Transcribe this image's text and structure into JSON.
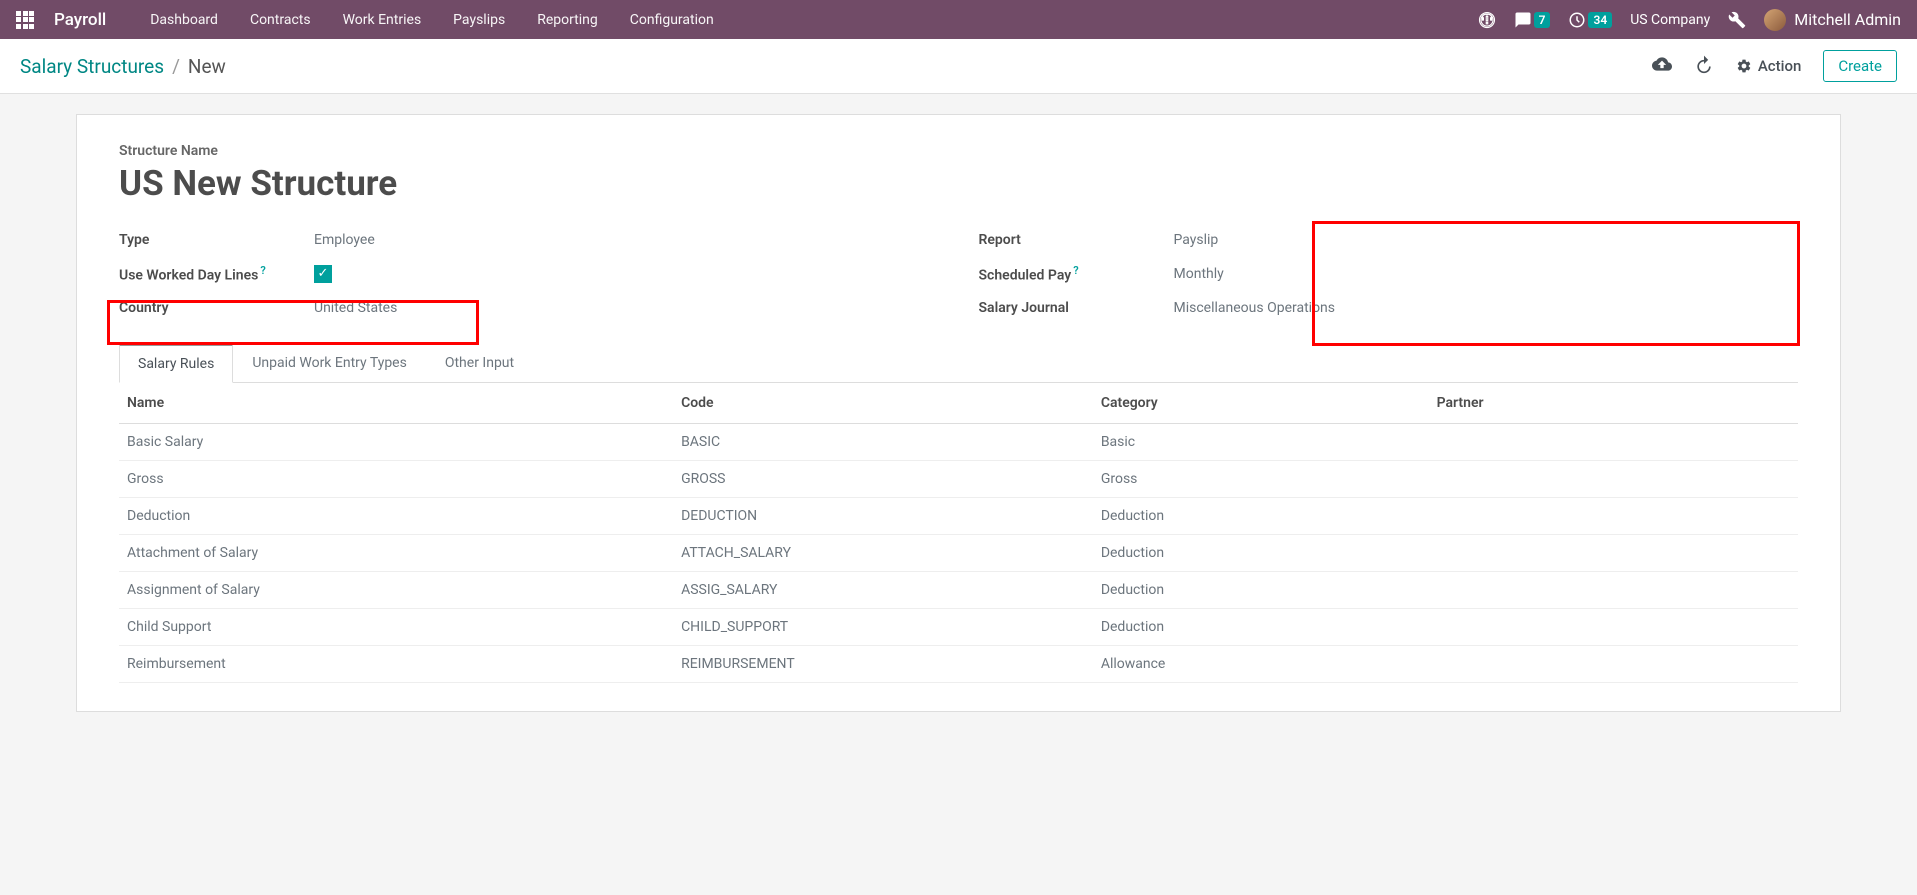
{
  "app_name": "Payroll",
  "nav": {
    "items": [
      "Dashboard",
      "Contracts",
      "Work Entries",
      "Payslips",
      "Reporting",
      "Configuration"
    ]
  },
  "header": {
    "messages_count": "7",
    "activities_count": "34",
    "company": "US Company",
    "user_name": "Mitchell Admin"
  },
  "breadcrumb": {
    "parent": "Salary Structures",
    "current": "New"
  },
  "actions": {
    "action_label": "Action",
    "create_label": "Create"
  },
  "form": {
    "structure_name_label": "Structure Name",
    "structure_name": "US New Structure",
    "type_label": "Type",
    "type_value": "Employee",
    "worked_day_label": "Use Worked Day Lines",
    "country_label": "Country",
    "country_value": "United States",
    "report_label": "Report",
    "report_value": "Payslip",
    "scheduled_pay_label": "Scheduled Pay",
    "scheduled_pay_value": "Monthly",
    "salary_journal_label": "Salary Journal",
    "salary_journal_value": "Miscellaneous Operations"
  },
  "tabs": {
    "items": [
      "Salary Rules",
      "Unpaid Work Entry Types",
      "Other Input"
    ]
  },
  "table": {
    "headers": {
      "name": "Name",
      "code": "Code",
      "category": "Category",
      "partner": "Partner"
    },
    "rows": [
      {
        "name": "Basic Salary",
        "code": "BASIC",
        "category": "Basic",
        "partner": ""
      },
      {
        "name": "Gross",
        "code": "GROSS",
        "category": "Gross",
        "partner": ""
      },
      {
        "name": "Deduction",
        "code": "DEDUCTION",
        "category": "Deduction",
        "partner": ""
      },
      {
        "name": "Attachment of Salary",
        "code": "ATTACH_SALARY",
        "category": "Deduction",
        "partner": ""
      },
      {
        "name": "Assignment of Salary",
        "code": "ASSIG_SALARY",
        "category": "Deduction",
        "partner": ""
      },
      {
        "name": "Child Support",
        "code": "CHILD_SUPPORT",
        "category": "Deduction",
        "partner": ""
      },
      {
        "name": "Reimbursement",
        "code": "REIMBURSEMENT",
        "category": "Allowance",
        "partner": ""
      }
    ]
  }
}
